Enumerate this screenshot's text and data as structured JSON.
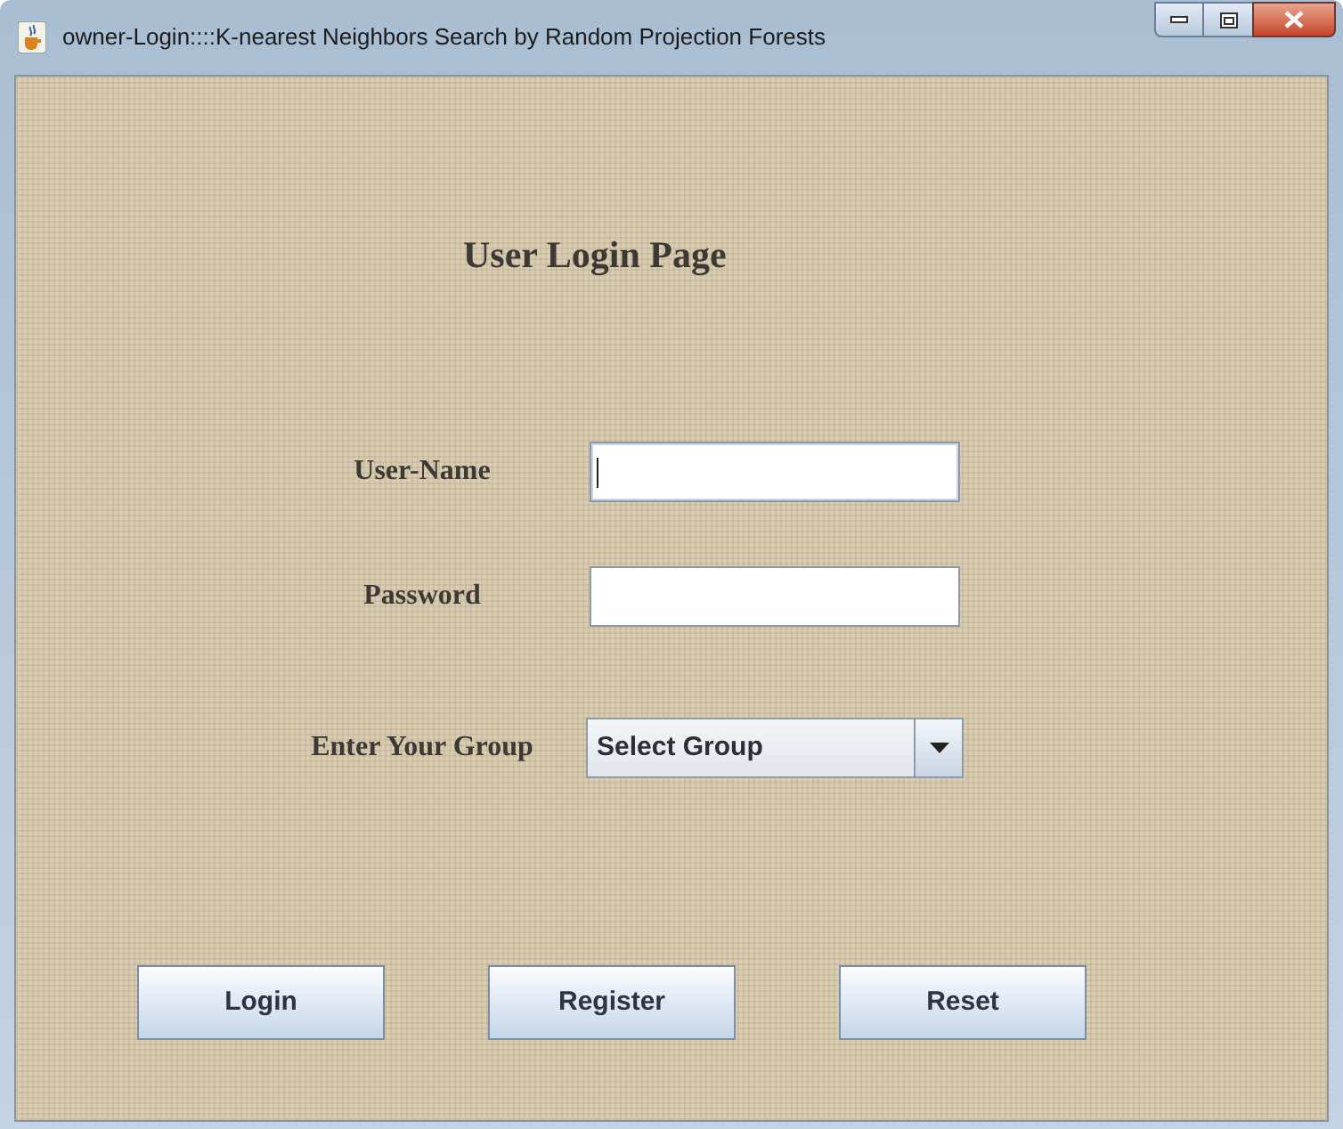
{
  "window": {
    "title": "owner-Login::::K-nearest Neighbors Search by Random Projection Forests"
  },
  "heading": "User Login Page",
  "fields": [
    {
      "kind": "text",
      "label": "User-Name",
      "focused": true
    },
    {
      "kind": "password",
      "label": "Password",
      "focused": false
    },
    {
      "kind": "dropdown",
      "label": "Enter Your Group",
      "value": "Select Group"
    }
  ],
  "buttons": [
    "Login",
    "Register",
    "Reset"
  ]
}
